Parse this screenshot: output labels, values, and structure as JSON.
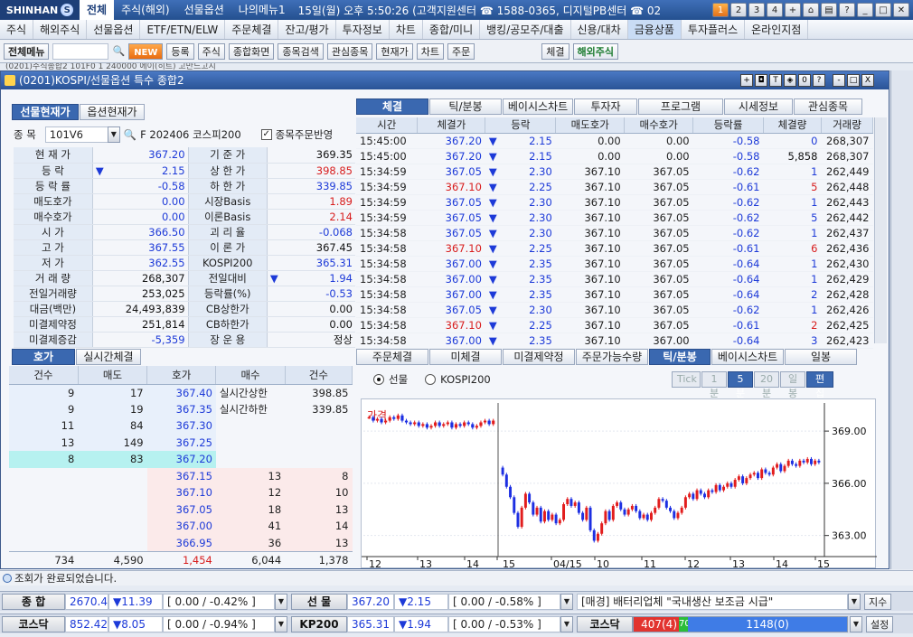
{
  "top": {
    "logo": "SHINHAN",
    "menus": [
      "전체",
      "주식(해외)",
      "선물옵션",
      "나의메뉴1"
    ],
    "info": "15일(월) 오후 5:50:26 (고객지원센터 ☎ 1588-0365, 디지털PB센터 ☎ 02",
    "page_buttons": [
      "1",
      "2",
      "3",
      "4"
    ]
  },
  "menubar": {
    "items": [
      "주식",
      "해외주식",
      "선물옵션",
      "ETF/ETN/ELW",
      "주문체결",
      "잔고/평가",
      "투자정보",
      "차트",
      "종합/미니",
      "뱅킹/공모주/대출",
      "신용/대차",
      "금융상품",
      "투자플러스",
      "온라인지점"
    ]
  },
  "toolbar": {
    "menu_label": "전체메뉴",
    "new_badge": "NEW",
    "reg": "등록",
    "stock_sel": "주식",
    "buttons": [
      "종합화면",
      "종목검색",
      "관심종목",
      "현재가",
      "차트",
      "주문"
    ],
    "right_btn": "체결",
    "overseas": "해외주식",
    "sub_line": "(0201)주식종합2    101F0 1 240000 에이(히트) 고만드고지"
  },
  "window": {
    "title": "(0201)KOSPI/선물옵션 특수 종합2",
    "title_btns": [
      "+",
      "◘",
      "T",
      "◈",
      "0",
      "?",
      "-",
      "□",
      "X"
    ],
    "left_tabs": [
      "선물현재가",
      "옵션현재가"
    ],
    "item_label": "종  목",
    "item_code": "101V6",
    "item_name": "F 202406 코스피200",
    "order_reflect": "종목주문반영"
  },
  "quote": [
    [
      "현 재 가",
      "367.20",
      "dn",
      "기 준 가",
      "369.35",
      "blk"
    ],
    [
      "등    락",
      "2.15",
      "dn",
      "상 한 가",
      "398.85",
      "up"
    ],
    [
      "등 락 률",
      "-0.58",
      "dn",
      "하 한 가",
      "339.85",
      "dn"
    ],
    [
      "매도호가",
      "0.00",
      "dn",
      "시장Basis",
      "1.89",
      "up"
    ],
    [
      "매수호가",
      "0.00",
      "dn",
      "이론Basis",
      "2.14",
      "up"
    ],
    [
      "시    가",
      "366.50",
      "dn",
      "괴 리 율",
      "-0.068",
      "dn"
    ],
    [
      "고    가",
      "367.55",
      "dn",
      "이 론 가",
      "367.45",
      "blk"
    ],
    [
      "저    가",
      "362.55",
      "dn",
      "KOSPI200",
      "365.31",
      "dn"
    ],
    [
      "거 래 량",
      "268,307",
      "blk",
      "전일대비",
      "1.94",
      "dn"
    ],
    [
      "전일거래량",
      "253,025",
      "blk",
      "등락률(%)",
      "-0.53",
      "dn"
    ],
    [
      "대금(백만)",
      "24,493,839",
      "blk",
      "CB상한가",
      "0.00",
      "blk"
    ],
    [
      "미결제약정",
      "251,814",
      "blk",
      "CB하한가",
      "0.00",
      "blk"
    ],
    [
      "미결제증감",
      "-5,359",
      "dn",
      "장 운 용",
      "정상",
      "blk"
    ]
  ],
  "trades": {
    "tabs": [
      "체결",
      "틱/분봉",
      "베이시스차트",
      "투자자",
      "프로그램",
      "시세정보",
      "관심종목"
    ],
    "headers": [
      "시간",
      "체결가",
      "등락",
      "매도호가",
      "매수호가",
      "등락률",
      "체결량",
      "거래량"
    ],
    "rows": [
      [
        "15:45:00",
        "367.20",
        "2.15",
        "0.00",
        "0.00",
        "-0.58",
        "0",
        "268,307",
        "dn"
      ],
      [
        "15:45:00",
        "367.20",
        "2.15",
        "0.00",
        "0.00",
        "-0.58",
        "5,858",
        "268,307",
        "blk"
      ],
      [
        "15:34:59",
        "367.05",
        "2.30",
        "367.10",
        "367.05",
        "-0.62",
        "1",
        "262,449",
        "dn"
      ],
      [
        "15:34:59",
        "367.10",
        "2.25",
        "367.10",
        "367.05",
        "-0.61",
        "5",
        "262,448",
        "up"
      ],
      [
        "15:34:59",
        "367.05",
        "2.30",
        "367.10",
        "367.05",
        "-0.62",
        "1",
        "262,443",
        "dn"
      ],
      [
        "15:34:59",
        "367.05",
        "2.30",
        "367.10",
        "367.05",
        "-0.62",
        "5",
        "262,442",
        "dn"
      ],
      [
        "15:34:58",
        "367.05",
        "2.30",
        "367.10",
        "367.05",
        "-0.62",
        "1",
        "262,437",
        "dn"
      ],
      [
        "15:34:58",
        "367.10",
        "2.25",
        "367.10",
        "367.05",
        "-0.61",
        "6",
        "262,436",
        "up"
      ],
      [
        "15:34:58",
        "367.00",
        "2.35",
        "367.10",
        "367.05",
        "-0.64",
        "1",
        "262,430",
        "dn"
      ],
      [
        "15:34:58",
        "367.00",
        "2.35",
        "367.10",
        "367.05",
        "-0.64",
        "1",
        "262,429",
        "dn"
      ],
      [
        "15:34:58",
        "367.00",
        "2.35",
        "367.10",
        "367.05",
        "-0.64",
        "2",
        "262,428",
        "dn"
      ],
      [
        "15:34:58",
        "367.05",
        "2.30",
        "367.10",
        "367.05",
        "-0.62",
        "1",
        "262,426",
        "dn"
      ],
      [
        "15:34:58",
        "367.10",
        "2.25",
        "367.10",
        "367.05",
        "-0.61",
        "2",
        "262,425",
        "up"
      ],
      [
        "15:34:58",
        "367.00",
        "2.35",
        "367.10",
        "367.00",
        "-0.64",
        "3",
        "262,423",
        "dn"
      ]
    ]
  },
  "orderbook": {
    "tabs": [
      "호가",
      "실시간체결"
    ],
    "headers": [
      "건수",
      "매도",
      "호가",
      "매수",
      "건수"
    ],
    "asks": [
      [
        "9",
        "17",
        "367.40"
      ],
      [
        "9",
        "19",
        "367.35"
      ],
      [
        "11",
        "84",
        "367.30"
      ],
      [
        "13",
        "149",
        "367.25"
      ],
      [
        "8",
        "83",
        "367.20"
      ]
    ],
    "info": [
      [
        "실시간상한",
        "398.85"
      ],
      [
        "실시간하한",
        "339.85"
      ]
    ],
    "bids": [
      [
        "367.15",
        "13",
        "8"
      ],
      [
        "367.10",
        "12",
        "10"
      ],
      [
        "367.05",
        "18",
        "13"
      ],
      [
        "367.00",
        "41",
        "14"
      ],
      [
        "366.95",
        "36",
        "13"
      ]
    ],
    "totals": [
      "734",
      "4,590",
      "1,454",
      "6,044",
      "1,378"
    ]
  },
  "chart_panel": {
    "tabs": [
      "주문체결",
      "미체결",
      "미결제약정",
      "주문가능수량",
      "틱/분봉",
      "베이시스차트",
      "일봉"
    ],
    "radio1": "선물",
    "radio2": "KOSPI200",
    "period_btns": [
      "Tick",
      "1분",
      "5분",
      "20분",
      "일봉",
      "편집"
    ],
    "legend": "가격"
  },
  "chart_data": {
    "type": "candlestick",
    "legend": "가격",
    "y_ticks": [
      363.0,
      366.0,
      369.0
    ],
    "y_tick_labels": [
      "363.00",
      "366.00",
      "369.00"
    ],
    "ylim": [
      362.1,
      370.2
    ],
    "x_tick_labels": [
      "12",
      "13",
      "14",
      "15",
      "04/15",
      "10",
      "11",
      "12",
      "13",
      "14",
      "15"
    ],
    "session1": [
      369.8,
      369.6,
      369.7,
      369.5,
      369.6,
      369.8,
      369.7,
      369.9,
      369.6,
      369.5,
      369.4,
      369.5,
      369.3,
      369.4,
      369.2,
      369.3,
      369.5,
      369.3,
      369.4,
      369.5,
      369.2,
      369.4,
      369.3,
      369.5,
      369.4,
      369.2,
      369.3,
      369.5,
      369.6,
      369.4,
      369.6
    ],
    "session2": [
      366.5,
      365.8,
      365.2,
      364.3,
      363.5,
      364.6,
      365.4,
      364.9,
      364.2,
      364.6,
      363.8,
      364.4,
      363.9,
      364.2,
      363.7,
      363.9,
      364.8,
      365.1,
      364.7,
      364.9,
      364.3,
      363.9,
      364.6,
      363.3,
      362.7,
      363.1,
      363.7,
      364.4,
      363.9,
      364.7,
      364.9,
      364.5,
      364.2,
      364.5,
      364.7,
      364.4,
      364.0,
      364.2,
      363.9,
      364.3,
      364.6,
      365.1,
      365.0,
      364.6,
      364.4,
      364.0,
      364.3,
      364.6,
      365.2,
      365.4,
      365.1,
      365.6,
      365.4,
      365.2,
      365.6,
      365.5,
      365.9,
      365.6,
      365.8,
      366.0,
      365.8,
      366.2,
      366.4,
      366.0,
      366.3,
      366.5,
      366.6,
      366.3,
      366.8,
      366.6,
      366.5,
      366.9,
      367.1,
      366.7,
      367.0,
      367.3,
      367.1,
      367.0,
      367.3,
      367.2,
      367.4,
      367.1,
      367.3,
      367.2
    ]
  },
  "status": "조회가 완료되었습니다.",
  "tickers": [
    {
      "label": "종  합",
      "value": "2670.43",
      "chg": "▼11.39",
      "range": "[ 0.00  / -0.42% ]",
      "label2": "선  물",
      "value2": "367.20",
      "chg2": "▼2.15",
      "range2": "[ 0.00  / -0.58% ]",
      "news": "[매경] 배터리업체 \"국내생산 보조금 시급\"",
      "btn": "지수"
    },
    {
      "label": "코스닥",
      "value": "852.42",
      "chg": "▼8.05",
      "range": "[ 0.00  / -0.94% ]",
      "label2": "KP200",
      "value2": "365.31",
      "chg2": "▼1.94",
      "range2": "[ 0.00  / -0.53% ]",
      "label3": "코스닥",
      "up": "407(4)",
      "mid": "70",
      "down": "1148(0)",
      "btn": "설정"
    }
  ],
  "colors": {
    "up": "#d81d1d",
    "down": "#1d3ad8",
    "accent": "#3a68b0"
  }
}
